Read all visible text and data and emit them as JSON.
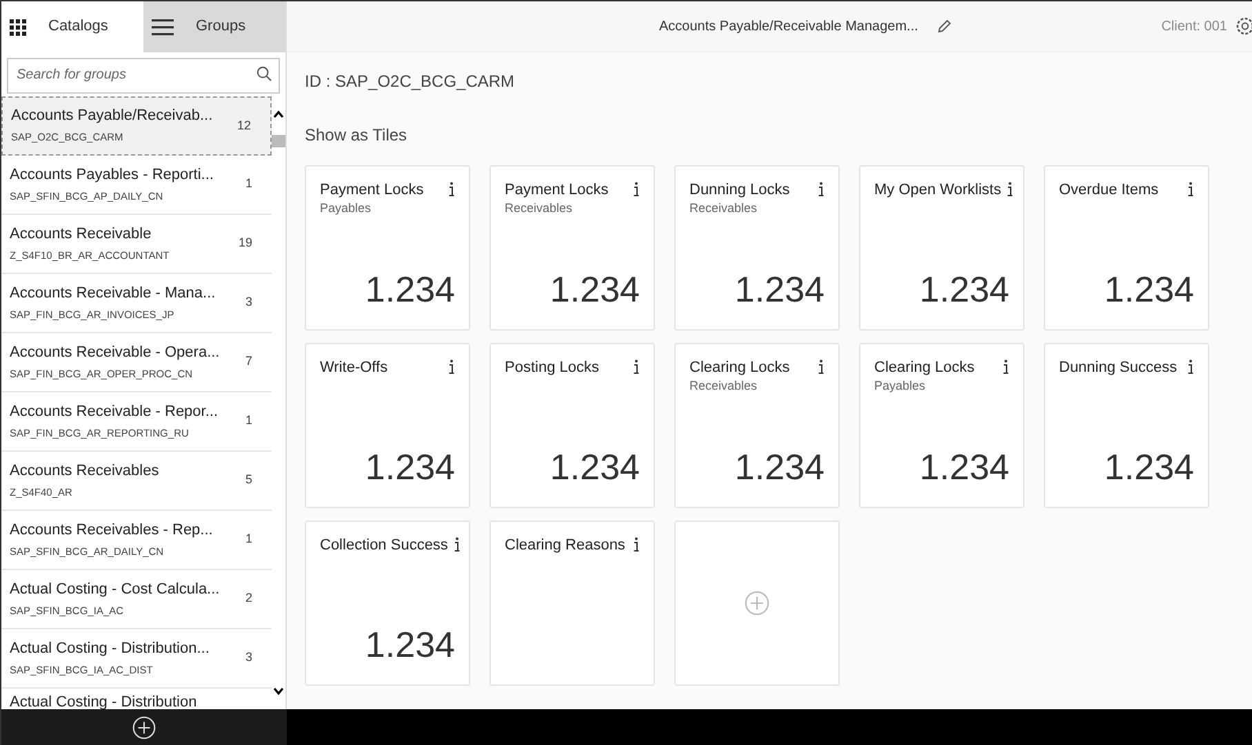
{
  "sidebar": {
    "tabs": [
      {
        "label": "Catalogs",
        "selected": false,
        "kind": "grid"
      },
      {
        "label": "Groups",
        "selected": true,
        "kind": "menu"
      }
    ],
    "search": {
      "placeholder": "Search for groups"
    },
    "items": [
      {
        "title": "Accounts Payable/Receivab...",
        "id": "SAP_O2C_BCG_CARM",
        "count": "12",
        "selected": true
      },
      {
        "title": "Accounts Payables - Reporti...",
        "id": "SAP_SFIN_BCG_AP_DAILY_CN",
        "count": "1",
        "selected": false
      },
      {
        "title": "Accounts Receivable",
        "id": "Z_S4F10_BR_AR_ACCOUNTANT",
        "count": "19",
        "selected": false
      },
      {
        "title": "Accounts Receivable - Mana...",
        "id": "SAP_FIN_BCG_AR_INVOICES_JP",
        "count": "3",
        "selected": false
      },
      {
        "title": "Accounts Receivable - Opera...",
        "id": "SAP_FIN_BCG_AR_OPER_PROC_CN",
        "count": "7",
        "selected": false
      },
      {
        "title": "Accounts Receivable - Repor...",
        "id": "SAP_FIN_BCG_AR_REPORTING_RU",
        "count": "1",
        "selected": false
      },
      {
        "title": "Accounts Receivables",
        "id": "Z_S4F40_AR",
        "count": "5",
        "selected": false
      },
      {
        "title": "Accounts Receivables - Rep...",
        "id": "SAP_SFIN_BCG_AR_DAILY_CN",
        "count": "1",
        "selected": false
      },
      {
        "title": "Actual Costing - Cost Calcula...",
        "id": "SAP_SFIN_BCG_IA_AC",
        "count": "2",
        "selected": false
      },
      {
        "title": "Actual Costing - Distribution...",
        "id": "SAP_SFIN_BCG_IA_AC_DIST",
        "count": "3",
        "selected": false
      },
      {
        "title": "Actual Costing - Distribution",
        "selected": false
      }
    ]
  },
  "header": {
    "title": "Accounts Payable/Receivable Managem...",
    "client": "Client: 001"
  },
  "group_id": "ID : SAP_O2C_BCG_CARM",
  "section_title": "Show as Tiles",
  "tiles": [
    {
      "kind": "kpi",
      "title": "Payment Locks",
      "subtitle": "Payables",
      "value": "1.234"
    },
    {
      "kind": "kpi",
      "title": "Payment Locks",
      "subtitle": "Receivables",
      "value": "1.234"
    },
    {
      "kind": "kpi",
      "title": "Dunning Locks",
      "subtitle": "Receivables",
      "value": "1.234"
    },
    {
      "kind": "kpi",
      "title": "My Open Worklists",
      "value": "1.234"
    },
    {
      "kind": "kpi",
      "title": "Overdue Items",
      "value": "1.234"
    },
    {
      "kind": "kpi",
      "title": "Write-Offs",
      "value": "1.234"
    },
    {
      "kind": "kpi",
      "title": "Posting Locks",
      "value": "1.234"
    },
    {
      "kind": "kpi",
      "title": "Clearing Locks",
      "subtitle": "Receivables",
      "value": "1.234"
    },
    {
      "kind": "kpi",
      "title": "Clearing Locks",
      "subtitle": "Payables",
      "value": "1.234"
    },
    {
      "kind": "kpi",
      "title": "Dunning Success",
      "value": "1.234"
    },
    {
      "kind": "kpi",
      "title": "Collection Success",
      "value": "1.234"
    },
    {
      "kind": "kpi",
      "title": "Clearing Reasons"
    },
    {
      "kind": "add"
    }
  ]
}
